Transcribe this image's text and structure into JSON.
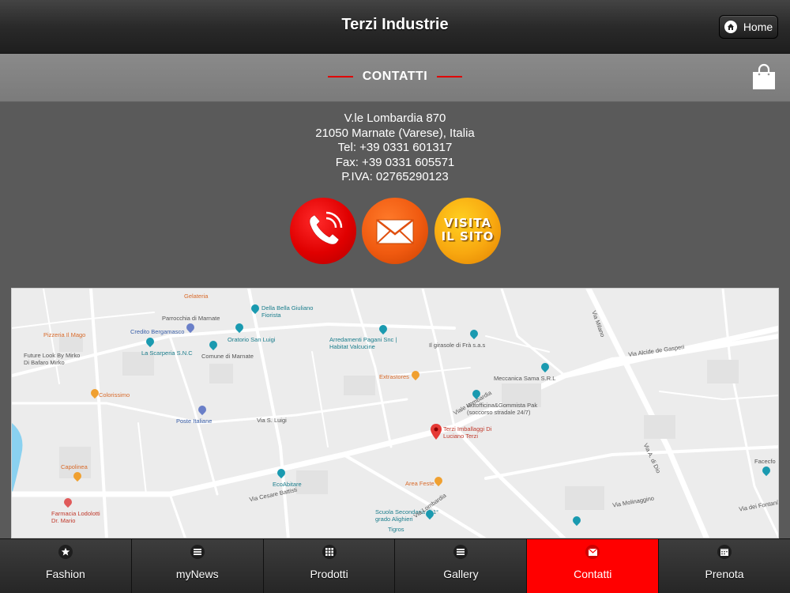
{
  "header": {
    "title": "Terzi Industrie",
    "home_label": "Home"
  },
  "section": {
    "title": "CONTATTI"
  },
  "contact": {
    "address": "V.le Lombardia 870",
    "city": "21050 Marnate (Varese), Italia",
    "tel": "Tel: +39 0331 601317",
    "fax": "Fax: +39 0331 605571",
    "piva": "P.IVA: 02765290123"
  },
  "actions": {
    "phone_icon": "phone-icon",
    "mail_icon": "envelope-icon",
    "site_label_line1": "VISITA",
    "site_label_line2": "IL SITO"
  },
  "map": {
    "labels": [
      "Gelateria",
      "Della Bella Giuliano Fiorista",
      "Pizzeria Il Mago",
      "Parrocchia di Marnate",
      "Credito Bergamasco",
      "Oratorio San Luigi",
      "La Scarperia S.N.C",
      "Comune di Marnate",
      "Future Look By Mirko Di Bafaro Mirko",
      "Arredamenti Pagani Snc | Habitat Valcucine",
      "Il girasole di Frà s.a.s",
      "Extrastores",
      "Meccanica Sama S.R.L",
      "Colorissimo",
      "Autofficina&Gommista Pak (soccorso stradale 24/7)",
      "Poste Italiane",
      "Terzi Imballaggi Di Luciano Terzi",
      "Capolinea",
      "EcoAbitare",
      "Area Feste",
      "Farmacia Lodolotti Dr. Mario",
      "Scuola Secondaria di 1° grado Alighieri",
      "Tigros",
      "Facecfo",
      "Via Alcide de Gasperi",
      "Via Lombardia",
      "Via Milano",
      "Via A. di Dio",
      "Via Cesare Battisti",
      "Via S. Luigi",
      "Viale Lombardia",
      "Via Molinaggino",
      "Via dei Fontanili"
    ]
  },
  "nav": [
    {
      "label": "Fashion",
      "icon": "star-icon"
    },
    {
      "label": "myNews",
      "icon": "list-icon"
    },
    {
      "label": "Prodotti",
      "icon": "grid-icon"
    },
    {
      "label": "Gallery",
      "icon": "list-icon"
    },
    {
      "label": "Contatti",
      "icon": "envelope-icon",
      "active": true
    },
    {
      "label": "Prenota",
      "icon": "calendar-icon"
    }
  ],
  "colors": {
    "accent": "#ff0000",
    "header_bg": "#2a2a2a",
    "section_bg": "#828282",
    "body_bg": "#5a5a5a"
  }
}
